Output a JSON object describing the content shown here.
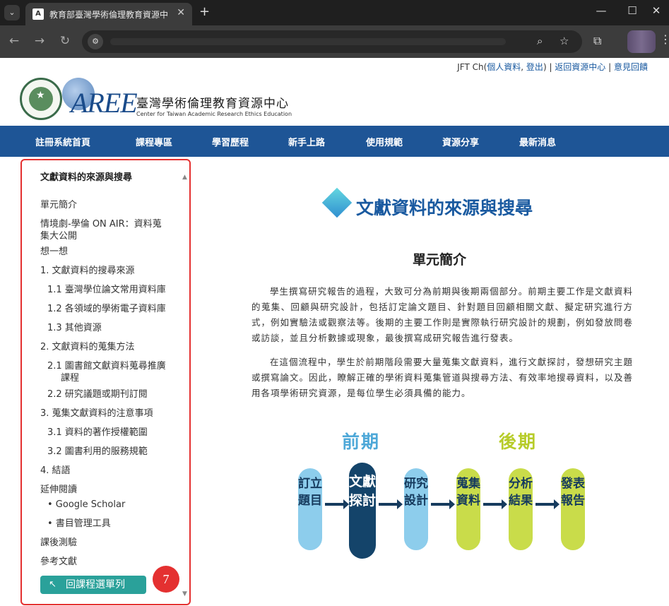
{
  "browser": {
    "tab_title": "教育部臺灣學術倫理教育資源中",
    "favicon_label": "A",
    "tab_close": "✕",
    "new_tab": "+",
    "tab_list_icon": "⌄",
    "nav": {
      "back": "←",
      "forward": "→",
      "reload": "↻"
    },
    "site_info_icon": "⚙",
    "zoom_icon": "⌕",
    "star_icon": "☆",
    "extension_icon": "⧉",
    "menu_icon": "⋮",
    "window": {
      "minimize": "—",
      "maximize": "☐",
      "close": "✕"
    }
  },
  "header": {
    "user_name": "JFT Ch(",
    "user_profile_link": "個人資料",
    "sep_comma": ", ",
    "logout_link": "登出",
    "sep_close": ")",
    "bar1": " | ",
    "return_resource_link": "返回資源中心",
    "bar2": " | ",
    "feedback_link": "意見回饋",
    "logo_text": "AREE",
    "site_name": "臺灣學術倫理教育資源中心",
    "site_name_en": "Center for Taiwan Academic Research Ethics Education"
  },
  "main_nav": [
    "註冊系統首頁",
    "課程專區",
    "學習歷程",
    "新手上路",
    "使用規範",
    "資源分享",
    "最新消息"
  ],
  "sidebar": {
    "title": "文獻資料的來源與搜尋",
    "items": [
      "單元簡介",
      "情境劇-學倫 ON AIR：資料蒐",
      "集大公開",
      "想一想",
      "1. 文獻資料的搜尋來源",
      "1.1 臺灣學位論文常用資料庫",
      "1.2 各領域的學術電子資料庫",
      "1.3 其他資源",
      "2. 文獻資料的蒐集方法",
      "2.1 圖書館文獻資料蒐尋推廣",
      "課程",
      "2.2 研究議題或期刊訂閱",
      "3. 蒐集文獻資料的注意事項",
      "3.1 資料的著作授權範圍",
      "3.2 圖書利用的服務規範",
      "4. 結語",
      "延伸閱讀",
      "• Google Scholar",
      "• 書目管理工具",
      "課後測驗",
      "參考文獻"
    ],
    "scroll_up": "▲",
    "scroll_down": "▼",
    "return_button": "回課程選單列",
    "return_icon": "↖",
    "step_badge": "7"
  },
  "content": {
    "title": "文獻資料的來源與搜尋",
    "section_title": "單元簡介",
    "para1": "學生撰寫研究報告的過程，大致可分為前期與後期兩個部分。前期主要工作是文獻資料的蒐集、回顧與研究設計，包括訂定論文題目、針對題目回顧相關文獻、擬定研究進行方式，例如實驗法或觀察法等。後期的主要工作則是實際執行研究設計的規劃，例如發放問卷或訪談，並且分析數據或現象，最後撰寫成研究報告進行發表。",
    "para2": "在這個流程中，學生於前期階段需要大量蒐集文獻資料，進行文獻探討，發想研究主題或撰寫論文。因此，瞭解正確的學術資料蒐集管道與搜尋方法、有效率地搜尋資料，以及善用各項學術研究資源，是每位學生必須具備的能力。",
    "phase_early": "前期",
    "phase_late": "後期",
    "steps": [
      "訂立題目",
      "文獻探討",
      "研究設計",
      "蒐集資料",
      "分析結果",
      "發表報告"
    ],
    "colors": {
      "early": "#8dcdec",
      "highlight": "#14446a",
      "late": "#c9dc4a",
      "phase_early": "#4ea8d8",
      "phase_late": "#b7cc2a"
    }
  }
}
